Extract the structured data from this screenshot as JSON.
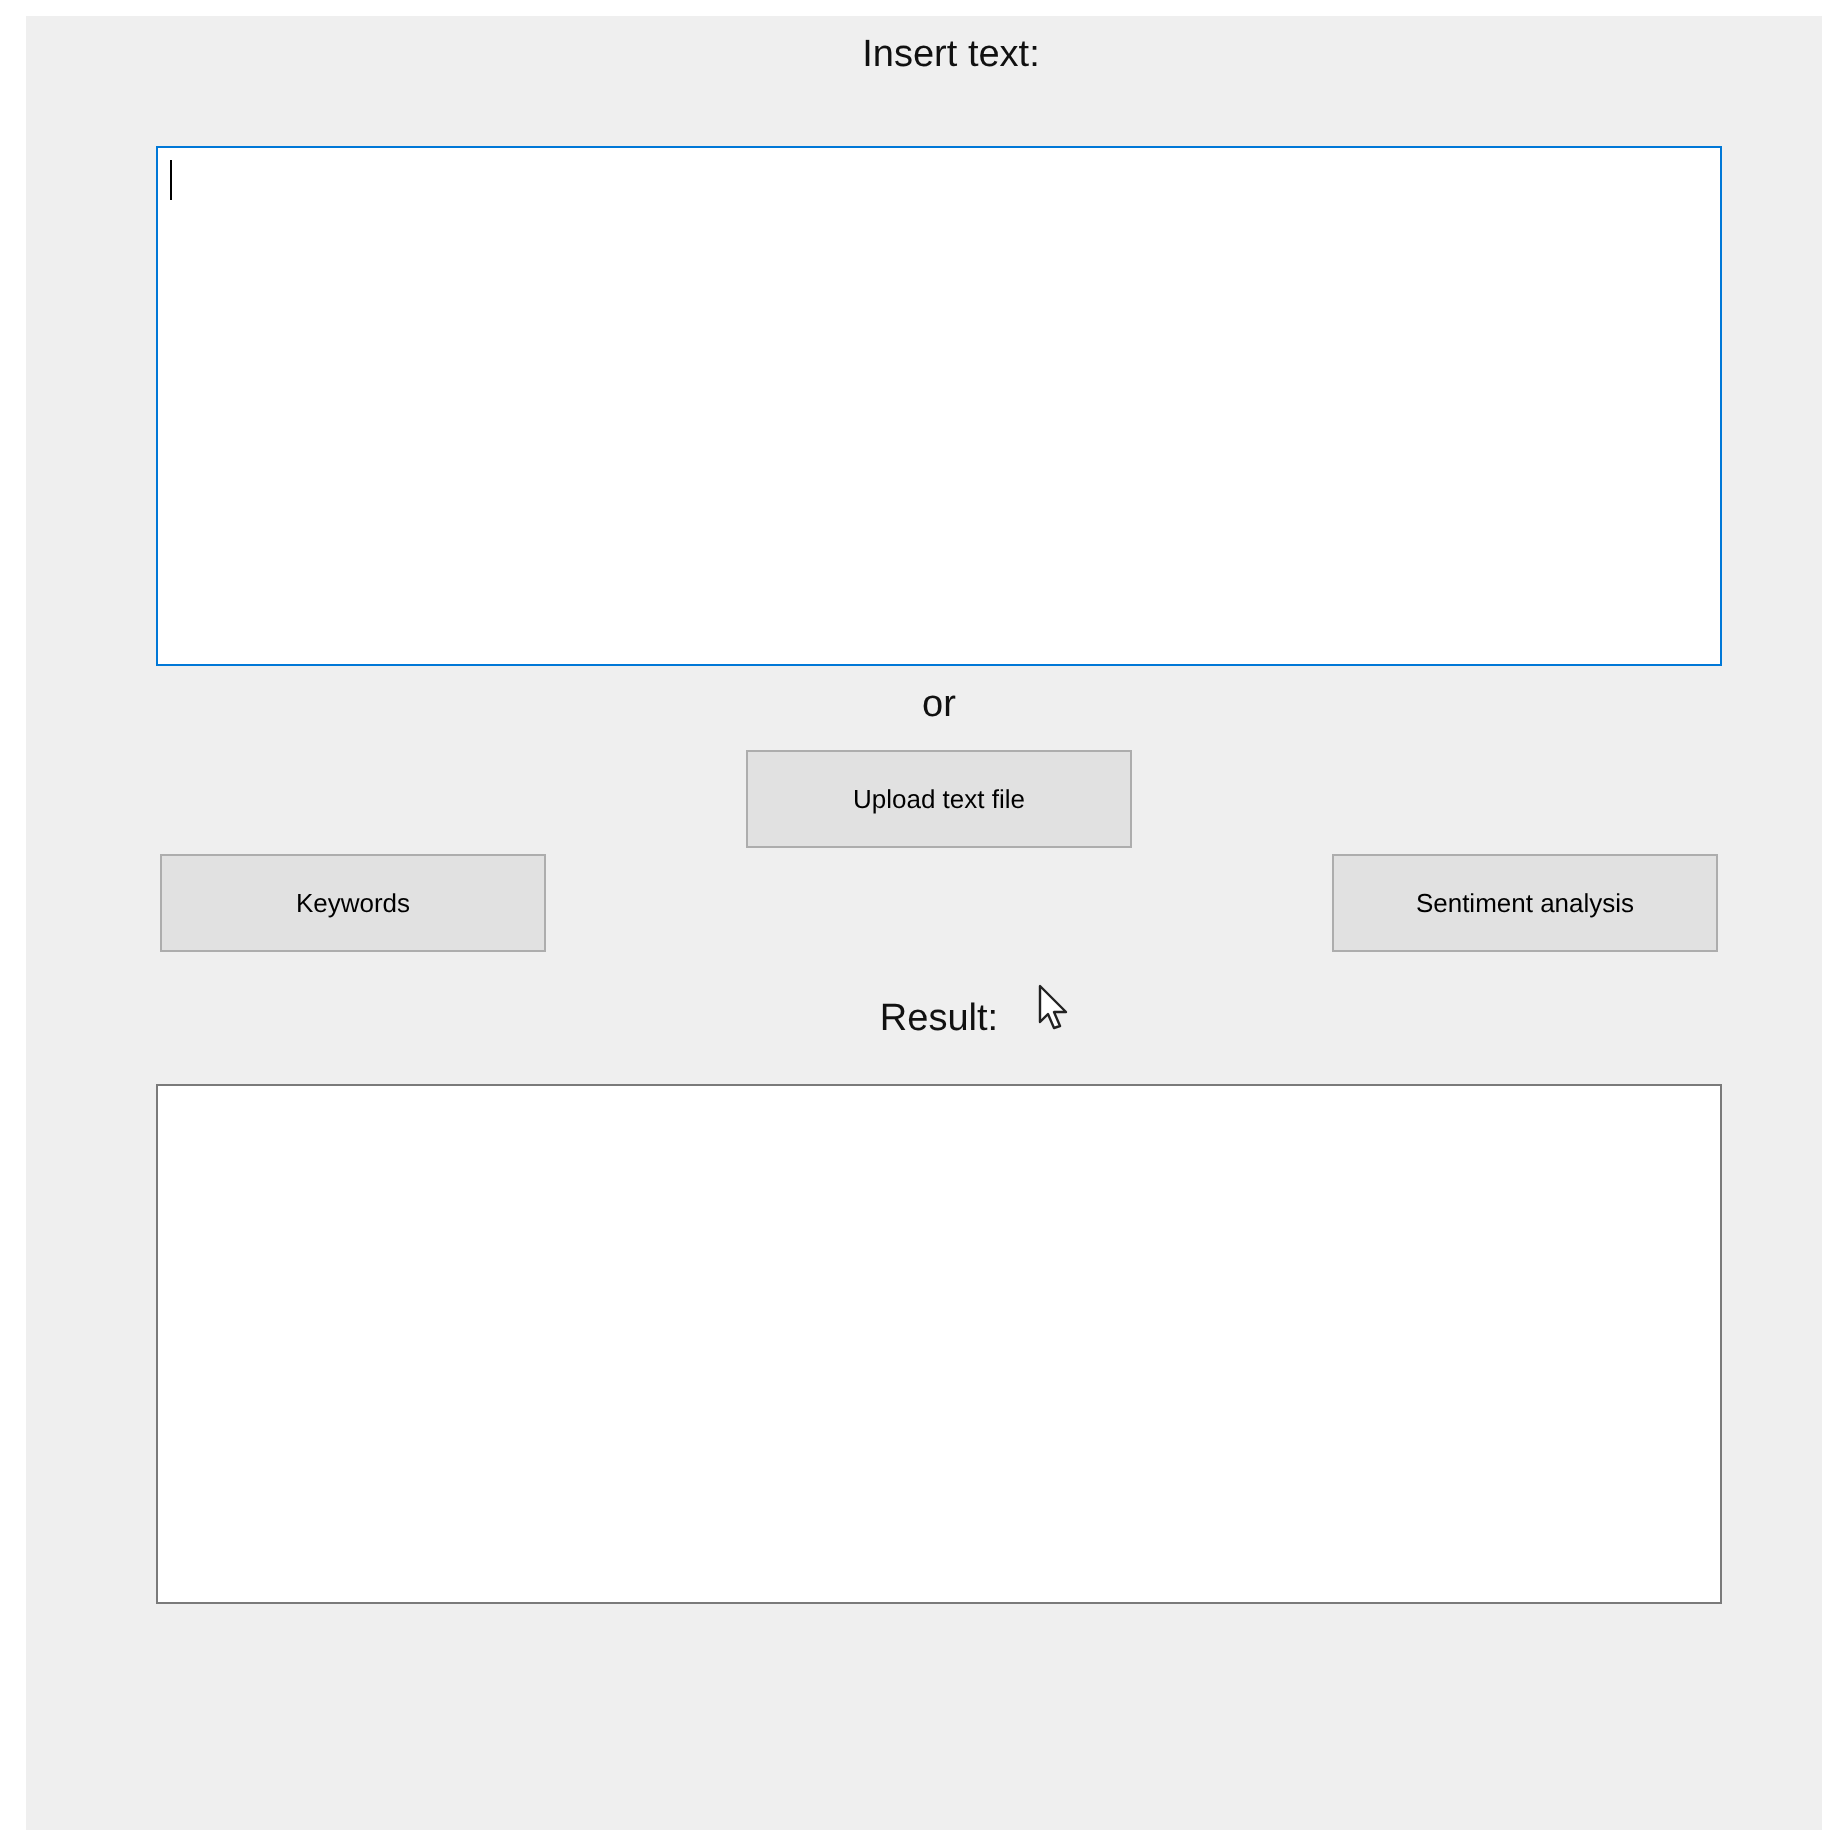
{
  "input_label": "Insert text:",
  "text_input": {
    "focused": true
  },
  "or_label": "or",
  "upload_button": "Upload text file",
  "buttons": [
    {
      "label": "Keywords"
    },
    {
      "label": "Sentiment analysis"
    }
  ],
  "result_label": "Result:"
}
